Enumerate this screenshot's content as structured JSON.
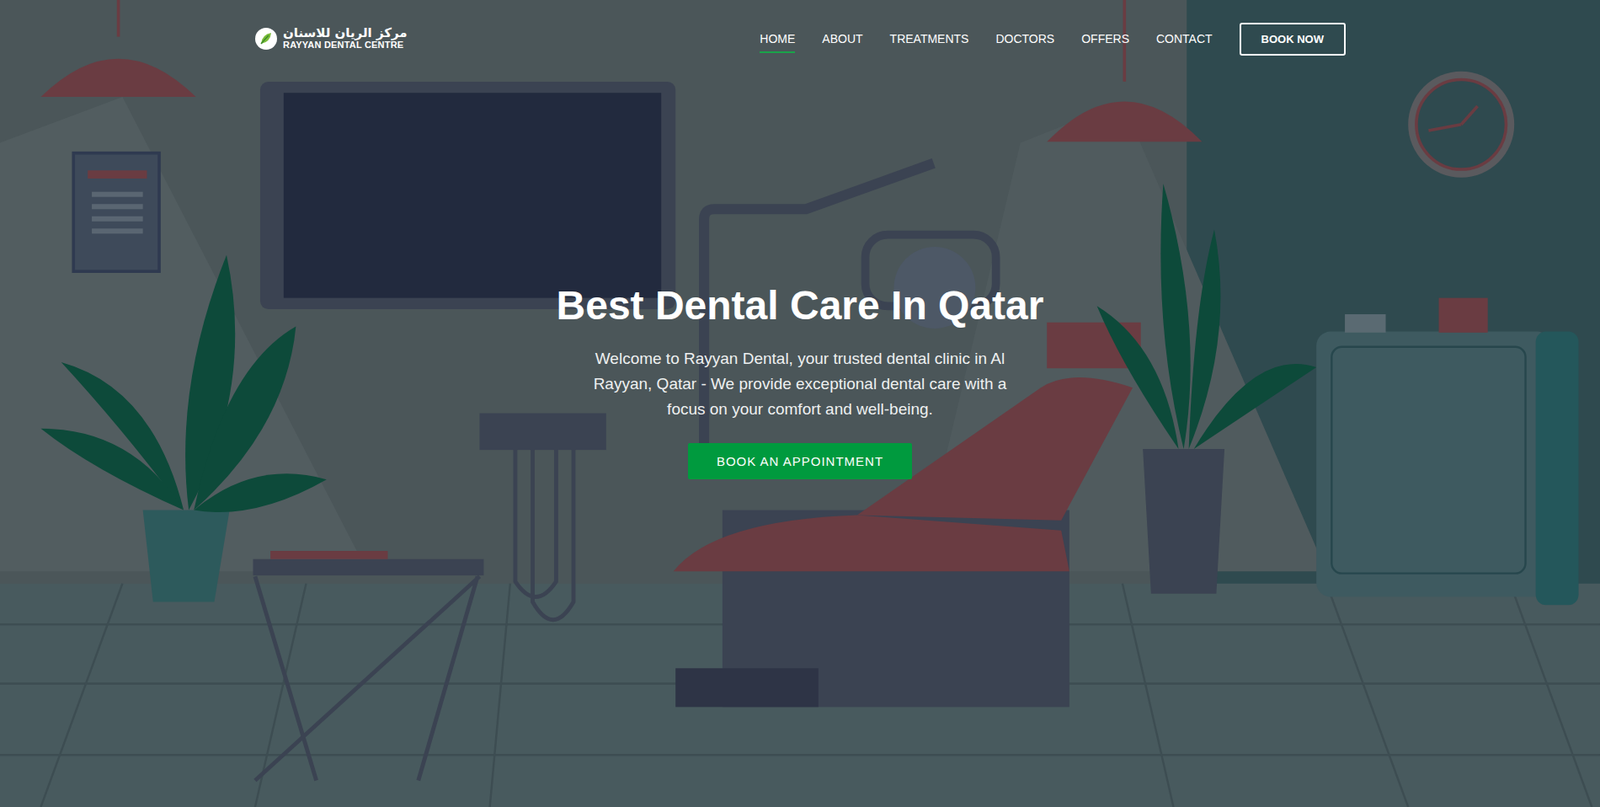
{
  "logo": {
    "arabic": "مركز الريان للاسنان",
    "english": "RAYYAN DENTAL CENTRE"
  },
  "nav": [
    {
      "label": "HOME",
      "selected": true
    },
    {
      "label": "ABOUT",
      "selected": false
    },
    {
      "label": "TREATMENTS",
      "selected": false
    },
    {
      "label": "DOCTORS",
      "selected": false
    },
    {
      "label": "OFFERS",
      "selected": false
    },
    {
      "label": "CONTACT",
      "selected": false
    }
  ],
  "book_button": "BOOK NOW",
  "hero": {
    "title": "Best Dental Care In Qatar",
    "text": "Welcome to Rayyan Dental, your trusted dental clinic in Al Rayyan, Qatar - We provide exceptional dental care with a focus on your comfort and well-being.",
    "button": "BOOK AN APPOINTMENT"
  }
}
